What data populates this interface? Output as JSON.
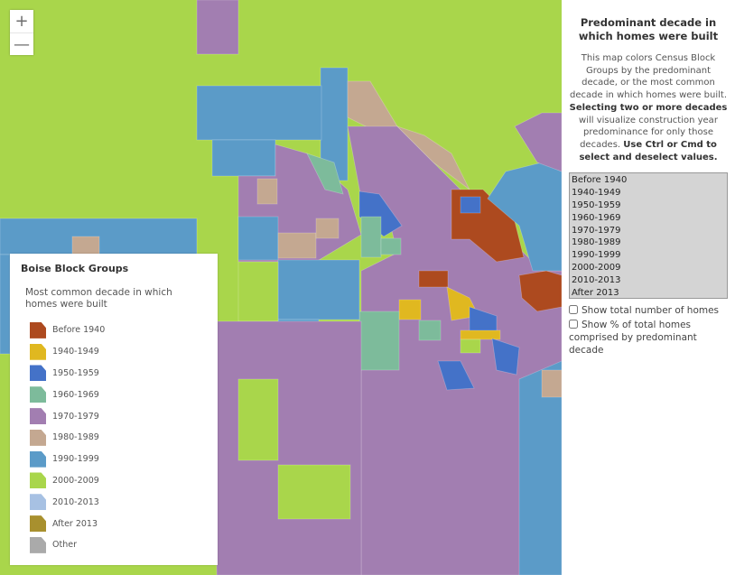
{
  "map": {
    "zoom_in": "+",
    "zoom_out": "—",
    "colors": {
      "2000-2009": "#a9d64b",
      "1970-1979": "#a27eb1",
      "1990-1999": "#5b9bc8",
      "1980-1989": "#c4a891",
      "1960-1969": "#7dbb9b",
      "1950-1959": "#4472c8",
      "Before 1940": "#ad4a1f",
      "1940-1949": "#e0b820"
    }
  },
  "legend": {
    "title": "Boise Block Groups",
    "subtitle": "Most common decade in which homes were built",
    "items": [
      {
        "label": "Before 1940",
        "color": "#ad4a1f"
      },
      {
        "label": "1940-1949",
        "color": "#e0b820"
      },
      {
        "label": "1950-1959",
        "color": "#4472c8"
      },
      {
        "label": "1960-1969",
        "color": "#7dbb9b"
      },
      {
        "label": "1970-1979",
        "color": "#a27eb1"
      },
      {
        "label": "1980-1989",
        "color": "#c4a891"
      },
      {
        "label": "1990-1999",
        "color": "#5b9bc8"
      },
      {
        "label": "2000-2009",
        "color": "#a9d64b"
      },
      {
        "label": "2010-2013",
        "color": "#a7c1e3"
      },
      {
        "label": "After 2013",
        "color": "#a8902e"
      },
      {
        "label": "Other",
        "color": "#aaaaaa"
      }
    ]
  },
  "panel": {
    "title": "Predominant decade in which homes were built",
    "desc1": "This map colors Census Block Groups by the predominant decade, or the most common decade in which homes were built.",
    "desc_bold1": "Selecting two or more decades",
    "desc2": "will visualize construction year predominance for only those decades.",
    "desc_bold2": "Use Ctrl or Cmd to select and deselect values.",
    "options": [
      "Before 1940",
      "1940-1949",
      "1950-1959",
      "1960-1969",
      "1970-1979",
      "1980-1989",
      "1990-1999",
      "2000-2009",
      "2010-2013",
      "After 2013"
    ],
    "checkbox1": "Show total number of homes",
    "checkbox2": "Show % of total homes comprised by predominant decade"
  }
}
